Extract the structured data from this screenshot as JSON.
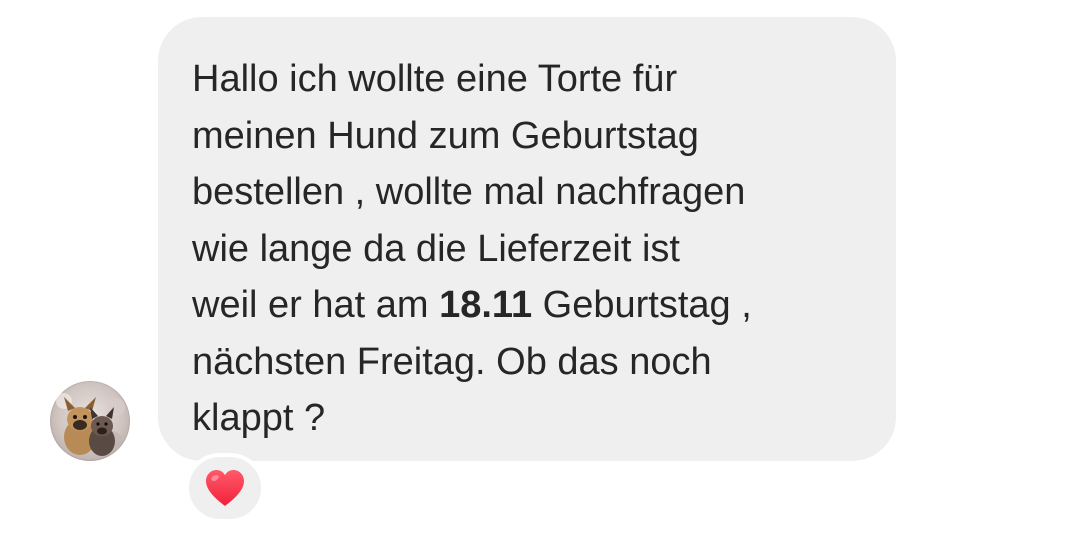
{
  "message": {
    "lines": [
      "Hallo ich wollte eine Torte für",
      "meinen Hund zum Geburtstag",
      "bestellen , wollte mal nachfragen",
      "wie lange da die Lieferzeit ist"
    ],
    "line5_before": "weil er hat am ",
    "line5_bold": "18.11",
    "line5_after": " Geburtstag ,",
    "line6": "nächsten Freitag. Ob das noch",
    "line7": "klappt ?"
  },
  "sender": {
    "avatar_icon": "profile-photo-two-dogs"
  },
  "reaction": {
    "icon": "heart-icon",
    "color": "#ff3040"
  },
  "colors": {
    "bubble": "#efefef",
    "text": "#262626"
  }
}
